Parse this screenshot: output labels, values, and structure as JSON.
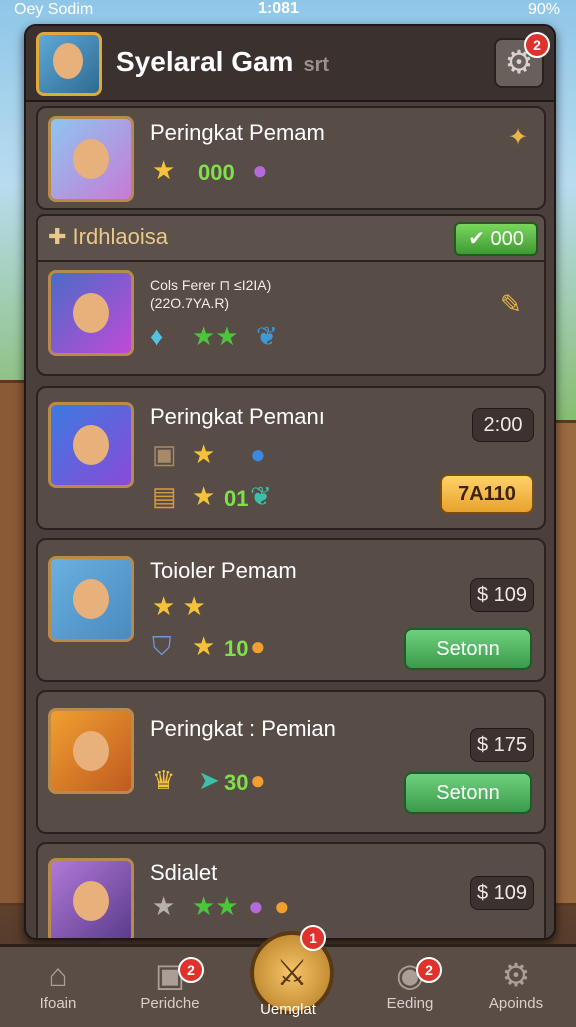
{
  "status": {
    "carrier": "Oey Sodim",
    "time": "1:081",
    "battery": "90%"
  },
  "header": {
    "title": "Syelaral Gam",
    "title_suffix": "srt",
    "settings_badge": "2"
  },
  "cards": [
    {
      "name": "Peringkat Pemam",
      "value": "000"
    },
    {
      "name": "Peringkat Pemanı",
      "time": "2:00",
      "button": "7A110"
    },
    {
      "name": "Toioler Pemam",
      "price": "$ 109",
      "stat": "10",
      "button": "Setonn"
    },
    {
      "name": "Peringkat : Pemian",
      "price": "$ 175",
      "stat": "30",
      "button": "Setonn"
    },
    {
      "name": "Sdialet",
      "price": "$ 109"
    }
  ],
  "section": {
    "label": "Irdhlaoisa",
    "value": "000",
    "text_line1": "Cols Ferer ⊓ ≤I2IA)",
    "text_line2": "(22O.7YA.R)"
  },
  "second_card_stat": "01",
  "nav": {
    "items": [
      {
        "label": "Ifoain",
        "icon": "home-icon"
      },
      {
        "label": "Peridche",
        "icon": "chest-icon",
        "badge": "2"
      },
      {
        "label": "Uemglat",
        "icon": "sword-icon",
        "badge": "1"
      },
      {
        "label": "Eeding",
        "icon": "shield-icon",
        "badge": "2"
      },
      {
        "label": "Apoinds",
        "icon": "gear-icon"
      }
    ]
  }
}
